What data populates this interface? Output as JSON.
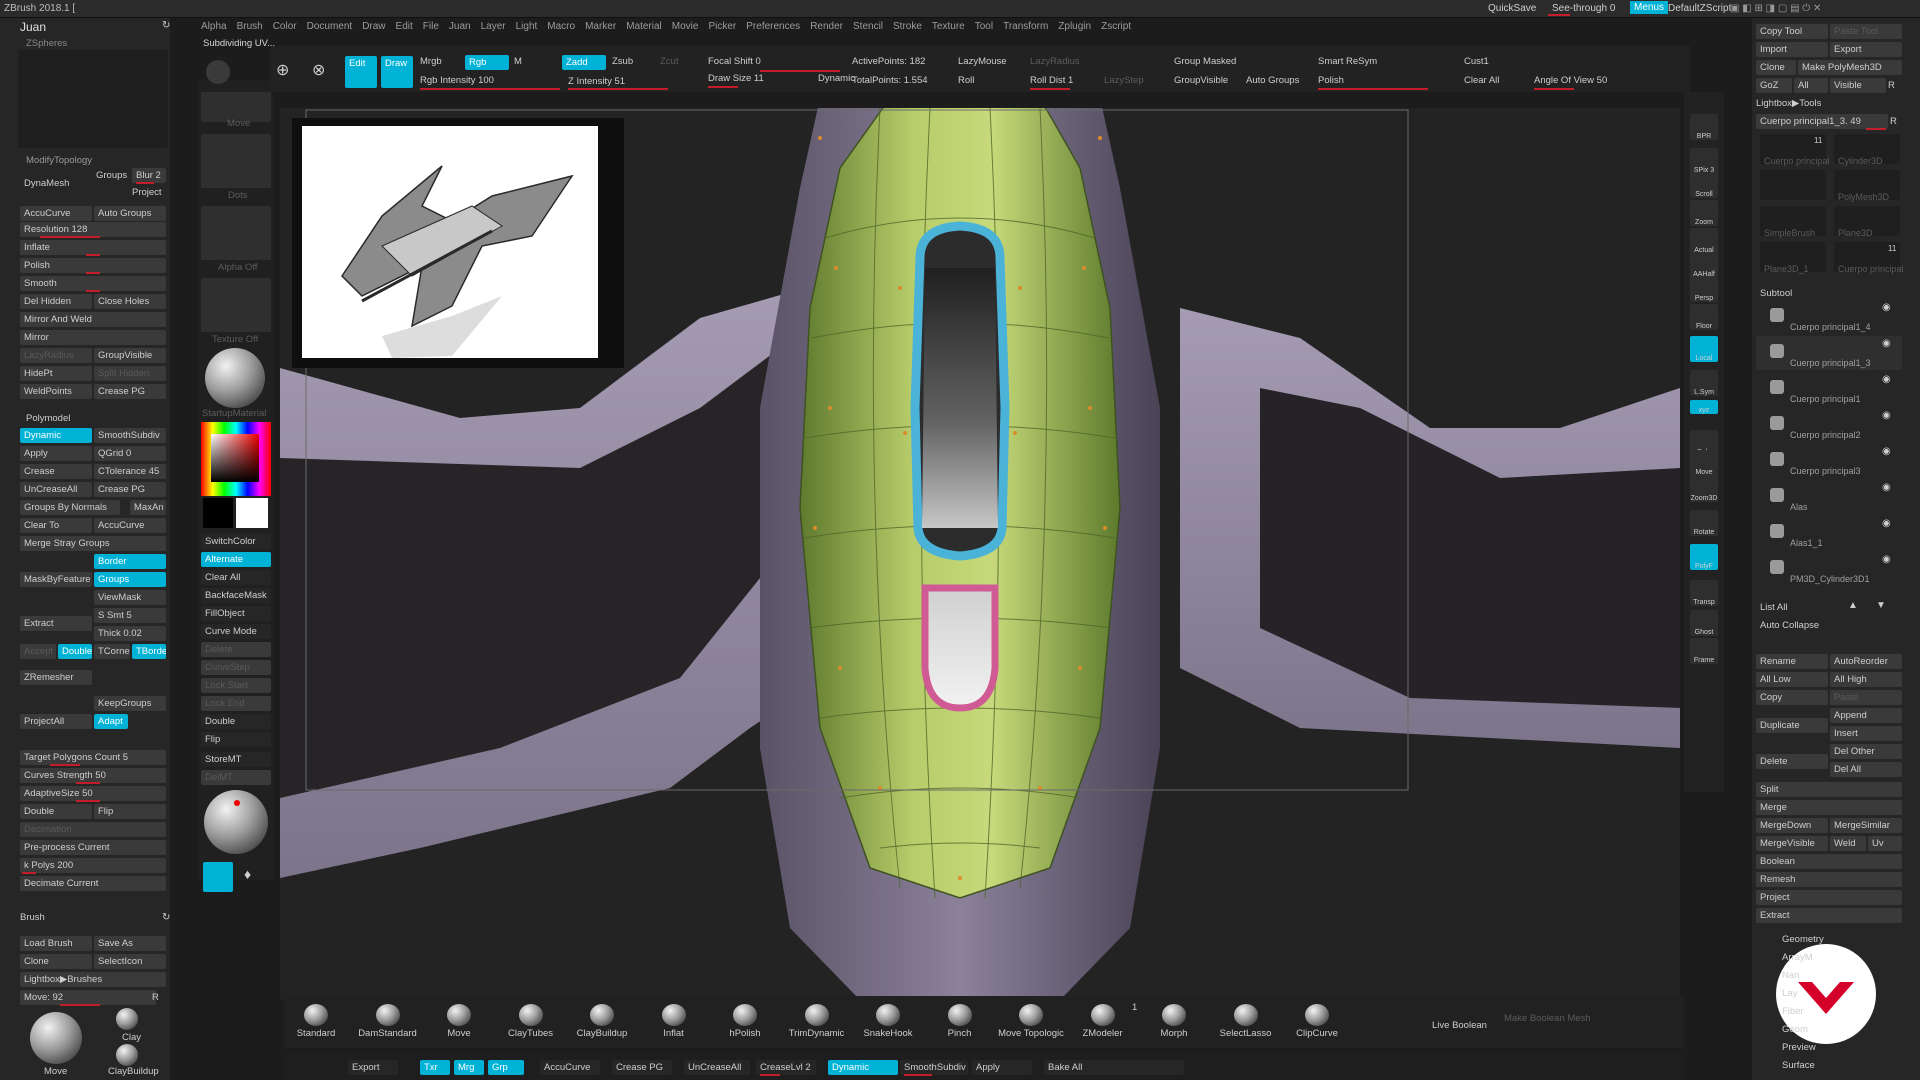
{
  "app": {
    "title": "ZBrush 2018.1 [",
    "quicksave": "QuickSave",
    "see_through": "See-through 0",
    "menus": "Menus",
    "default_zscript": "DefaultZScript",
    "status": "Subdividing UV..."
  },
  "menubar": [
    "Alpha",
    "Brush",
    "Color",
    "Document",
    "Draw",
    "Edit",
    "File",
    "Juan",
    "Layer",
    "Light",
    "Macro",
    "Marker",
    "Material",
    "Movie",
    "Picker",
    "Preferences",
    "Render",
    "Stencil",
    "Stroke",
    "Texture",
    "Tool",
    "Transform",
    "Zplugin",
    "Zscript"
  ],
  "juan_palette": {
    "title": "Juan",
    "zspheres": "ZSpheres"
  },
  "modify_topology": {
    "title": "ModifyTopology",
    "dynamesh": "DynaMesh",
    "groups": "Groups",
    "blur": "Blur 2",
    "project": "Project",
    "accucurve": "AccuCurve",
    "auto_groups": "Auto Groups",
    "resolution": "Resolution 128",
    "inflate": "Inflate",
    "polish": "Polish",
    "smooth": "Smooth",
    "del_hidden": "Del Hidden",
    "close_holes": "Close Holes",
    "mirror_and_weld": "Mirror And Weld",
    "mirror": "Mirror",
    "lazyradius": "LazyRadius",
    "groupvisible": "GroupVisible",
    "hidept": "HidePt",
    "split_hidden": "Split Hidden",
    "weldpoints": "WeldPoints",
    "crease_pg": "Crease PG"
  },
  "polymodel": {
    "title": "Polymodel",
    "dynamic": "Dynamic",
    "smoothsubdiv": "SmoothSubdiv",
    "apply": "Apply",
    "qgrid": "QGrid 0",
    "crease": "Crease",
    "ctolerance": "CTolerance 45",
    "uncreaseall": "UnCreaseAll",
    "crease_pg": "Crease PG",
    "groups_by_normals": "Groups By Normals",
    "maxangle": "MaxAn",
    "clear_to": "Clear To",
    "accucurve": "AccuCurve",
    "merge_stray_groups": "Merge Stray Groups",
    "border": "Border",
    "maskbyfeature": "MaskByFeature",
    "groups": "Groups",
    "viewmask": "ViewMask",
    "extract": "Extract",
    "s_smt": "S Smt 5",
    "thick": "Thick 0.02",
    "accept": "Accept",
    "double": "Double",
    "tcorne": "TCorne",
    "tborder": "TBorde",
    "zremesher": "ZRemesher",
    "keepgroups": "KeepGroups",
    "projectall": "ProjectAll",
    "adapt": "Adapt",
    "target_polygons": "Target Polygons Count 5",
    "curves_strength": "Curves Strength 50",
    "adaptivesize": "AdaptiveSize 50",
    "double2": "Double",
    "flip": "Flip",
    "decimation": "Decimation",
    "preprocess": "Pre-process Current",
    "kpolys": "k Polys 200",
    "decimate_current": "Decimate Current"
  },
  "brush_palette": {
    "title": "Brush",
    "load_brush": "Load Brush",
    "save_as": "Save As",
    "clone": "Clone",
    "selecticon": "SelectIcon",
    "lightbox": "Lightbox▶Brushes",
    "move": "Move: 92",
    "r": "R",
    "cur_brush": "Move",
    "clay": "Clay",
    "claybuildup": "ClayBuildup"
  },
  "shelf": {
    "move": "Move",
    "dots": "Dots",
    "alpha_off": "Alpha Off",
    "texture_off": "Texture Off",
    "startupmaterial": "StartupMaterial",
    "switchcolor": "SwitchColor",
    "alternate": "Alternate",
    "clear_all": "Clear All",
    "backfacemask": "BackfaceMask",
    "fillobject": "FillObject",
    "curve_mode": "Curve Mode",
    "delete": "Delete",
    "curvestep": "CurveStep",
    "lock_start": "Lock Start",
    "lock_end": "Lock End",
    "double": "Double",
    "flip": "Flip",
    "storemt": "StoreMT",
    "delmt": "DelMT"
  },
  "top_toolbar": {
    "edit": "Edit",
    "draw": "Draw",
    "mrgb": "Mrgb",
    "rgb": "Rgb",
    "m": "M",
    "zadd": "Zadd",
    "zsub": "Zsub",
    "zcut": "Zcut",
    "rgb_intensity": "Rgb Intensity 100",
    "z_intensity": "Z Intensity 51",
    "focal_shift": "Focal Shift 0",
    "draw_size": "Draw Size 11",
    "dynamic": "Dynamic",
    "active_points": "ActivePoints: 182",
    "total_points": "TotalPoints: 1.554",
    "lazymouse": "LazyMouse",
    "lazyradius": "LazyRadius",
    "roll": "Roll",
    "roll_dist": "Roll Dist 1",
    "lazystep": "LazyStep",
    "group_masked": "Group Masked",
    "groupvisible": "GroupVisible",
    "auto_groups": "Auto Groups",
    "smart_resym": "Smart ReSym",
    "polish": "Polish",
    "cust1": "Cust1",
    "clear_all": "Clear All",
    "angle_of_view": "Angle Of View 50"
  },
  "right_nav": [
    "BPR",
    "SPix 3",
    "Scroll",
    "Zoom",
    "Actual",
    "AAHalf",
    "Persp",
    "Floor",
    "Local",
    "L.Sym",
    "xyz",
    "Solo",
    "Move",
    "Zoom3D",
    "Rotate",
    "PolyF",
    "Transp",
    "Ghost",
    "Frame"
  ],
  "tool_palette": {
    "copy_tool": "Copy Tool",
    "paste_tool": "Paste Tool",
    "import": "Import",
    "export": "Export",
    "clone": "Clone",
    "make_polymesh": "Make PolyMesh3D",
    "goz": "GoZ",
    "all": "All",
    "visible": "Visible",
    "r": "R",
    "lightbox_tools": "Lightbox▶Tools",
    "current_tool": "Cuerpo principal1_3. 49",
    "r2": "R",
    "thumbs": [
      {
        "label": "Cuerpo principal",
        "badge": "11"
      },
      {
        "label": "Cylinder3D",
        "badge": ""
      },
      {
        "label": "",
        "badge": ""
      },
      {
        "label": "PolyMesh3D",
        "badge": ""
      },
      {
        "label": "SimpleBrush",
        "badge": ""
      },
      {
        "label": "Plane3D",
        "badge": ""
      },
      {
        "label": "Plane3D_1",
        "badge": ""
      },
      {
        "label": "Cuerpo principal",
        "badge": "11"
      }
    ]
  },
  "subtool": {
    "title": "Subtool",
    "items": [
      "Cuerpo principal1_4",
      "Cuerpo principal1_3",
      "Cuerpo principal1",
      "Cuerpo principal2",
      "Cuerpo principal3",
      "Alas",
      "Alas1_1",
      "PM3D_Cylinder3D1"
    ],
    "list_all": "List All",
    "auto_collapse": "Auto Collapse",
    "rename": "Rename",
    "autoreorder": "AutoReorder",
    "all_low": "All Low",
    "all_high": "All High",
    "copy": "Copy",
    "paste": "Paste",
    "duplicate": "Duplicate",
    "append": "Append",
    "insert": "Insert",
    "delete": "Delete",
    "del_other": "Del Other",
    "del_all": "Del All",
    "split": "Split",
    "merge": "Merge",
    "mergedown": "MergeDown",
    "mergesimilar": "MergeSimilar",
    "mergevisible": "MergeVisible",
    "weld": "Weld",
    "uv": "Uv",
    "boolean": "Boolean",
    "remesh": "Remesh",
    "project": "Project",
    "extract": "Extract",
    "sections": [
      "Geometry",
      "ArrayM",
      "Nan",
      "Lay",
      "Fiber",
      "Geom",
      "Preview",
      "Surface"
    ]
  },
  "bottom_brushes": [
    "Standard",
    "DamStandard",
    "Move",
    "ClayTubes",
    "ClayBuildup",
    "Inflat",
    "hPolish",
    "TrimDynamic",
    "SnakeHook",
    "Pinch",
    "Move Topologic",
    "ZModeler",
    "Morph",
    "SelectLasso",
    "ClipCurve"
  ],
  "bottom_badge": "1",
  "live_boolean": "Live Boolean",
  "make_boolean_mesh": "Make Boolean Mesh",
  "bottom_bar": {
    "export": "Export",
    "txr": "Txr",
    "mrg": "Mrg",
    "grp": "Grp",
    "accucurve": "AccuCurve",
    "crease_pg": "Crease PG",
    "uncreaseall": "UnCreaseAll",
    "creaselvl": "CreaseLvl 2",
    "dynamic": "Dynamic",
    "smoothsubdiv": "SmoothSubdiv",
    "apply": "Apply",
    "bake_all": "Bake All"
  },
  "colors": {
    "accent": "#00b3d6",
    "slider": "#c21d2a",
    "mesh_green": "#a8bf5c",
    "mesh_lavender": "#8f869c",
    "crease_blue": "#4bb2d8",
    "crease_pink": "#d05a93"
  }
}
